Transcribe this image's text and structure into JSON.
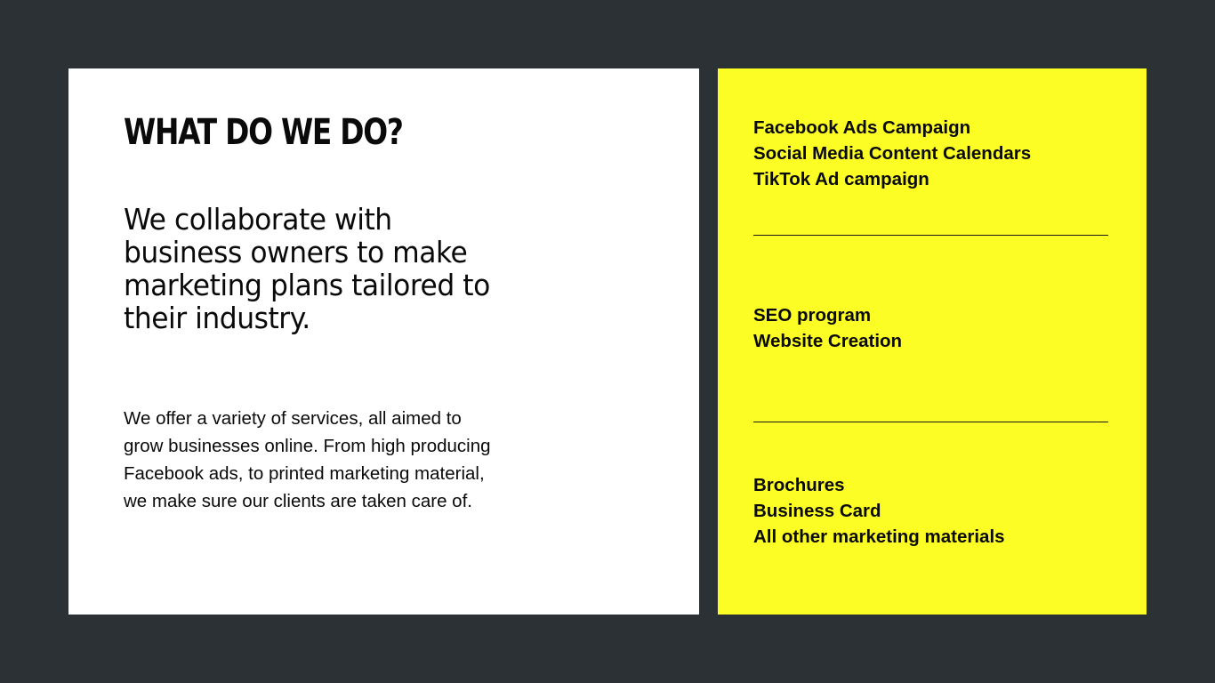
{
  "left": {
    "heading": "WHAT DO WE DO?",
    "lead": "We collaborate with business owners to make marketing plans tailored to their industry.",
    "body": "We offer a variety of services, all aimed to grow businesses online. From high producing Facebook ads, to  printed marketing material, we make sure our clients are taken care of."
  },
  "services": {
    "group1": [
      "Facebook Ads Campaign",
      "Social Media Content Calendars",
      "TikTok Ad campaign"
    ],
    "group2": [
      "SEO program",
      "Website Creation"
    ],
    "group3": [
      "Brochures",
      "Business Card",
      "All other marketing materials"
    ]
  },
  "colors": {
    "background": "#2c3135",
    "card": "#ffffff",
    "accent": "#fdfd26",
    "text": "#0a0a0a"
  }
}
